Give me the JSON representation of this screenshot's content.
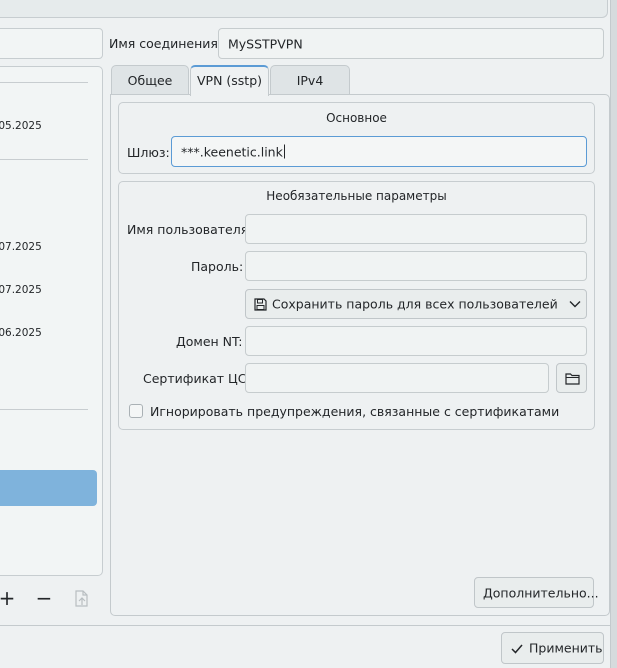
{
  "window": {
    "connection_name_label": "Имя соединения:",
    "connection_name_value": "MySSTPVPN"
  },
  "left_list": {
    "dates": [
      ".05.2025",
      ".07.2025",
      ".07.2025",
      ".06.2025"
    ]
  },
  "left_toolbar": {
    "add_symbol": "+",
    "remove_symbol": "−"
  },
  "tabs": [
    {
      "label": "Общее",
      "active": false
    },
    {
      "label": "VPN (sstp)",
      "active": true
    },
    {
      "label": "IPv4",
      "active": false
    }
  ],
  "basic_group": {
    "title": "Основное",
    "gateway_label": "Шлюз:",
    "gateway_value": "***.keenetic.link"
  },
  "optional_group": {
    "title": "Необязательные параметры",
    "username_label": "Имя пользователя:",
    "username_value": "",
    "password_label": "Пароль:",
    "password_value": "",
    "password_storage_option": "Сохранить пароль для всех пользователей (незашифрованный)",
    "nt_domain_label": "Домен NT:",
    "nt_domain_value": "",
    "ca_cert_label": "Сертификат ЦС:",
    "ca_cert_value": "",
    "ignore_cert_warnings_label": "Игнорировать предупреждения, связанные с сертификатами",
    "ignore_cert_warnings_checked": false
  },
  "advanced_button_label": "Дополнительно...",
  "apply_button_label": "Применить",
  "colors": {
    "accent": "#5b9bd5",
    "selection": "#7fb3dc",
    "background": "#eef1f2"
  }
}
